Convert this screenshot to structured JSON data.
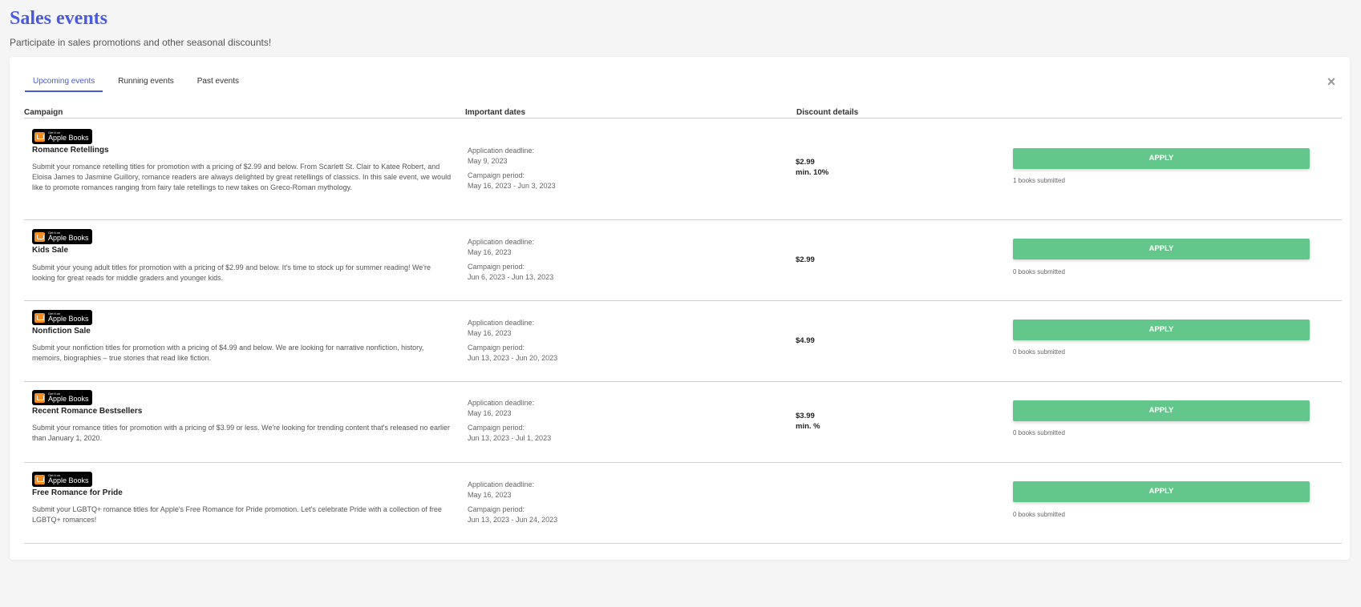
{
  "header": {
    "title": "Sales events",
    "subtitle": "Participate in sales promotions and other seasonal discounts!"
  },
  "tabs": [
    {
      "label": "Upcoming events",
      "active": true
    },
    {
      "label": "Running events",
      "active": false
    },
    {
      "label": "Past events",
      "active": false
    }
  ],
  "close_icon": "×",
  "table": {
    "headers": [
      "Campaign",
      "Important dates",
      "Discount details"
    ],
    "logo": {
      "small": "Get it on",
      "big": "Apple Books"
    },
    "labels": {
      "deadline": "Application deadline:",
      "period": "Campaign period:",
      "apply": "APPLY"
    },
    "rows": [
      {
        "name": "Romance Retellings",
        "description": "Submit your romance retelling titles for promotion with a pricing of $2.99 and below. From Scarlett St. Clair to Katee Robert, and Eloisa James to Jasmine Guillory, romance readers are always delighted by great retellings of classics. In this sale event, we would like to promote romances ranging from fairy tale retellings to new takes on Greco-Roman mythology.",
        "deadline": "May 9, 2023",
        "period": "May 16, 2023 - Jun 3, 2023",
        "price": "$2.99",
        "min": "min. 10%",
        "submitted": "1 books submitted"
      },
      {
        "name": "Kids Sale",
        "description": "Submit your young adult titles for promotion with a pricing of $2.99 and below. It's time to stock up for summer reading! We're looking for great reads for middle graders and younger kids.",
        "deadline": "May 16, 2023",
        "period": "Jun 6, 2023 - Jun 13, 2023",
        "price": "$2.99",
        "min": "",
        "submitted": "0 books submitted"
      },
      {
        "name": "Nonfiction Sale",
        "description": "Submit your nonfiction titles for promotion with a pricing of $4.99 and below. We are looking for narrative nonfiction, history, memoirs, biographies – true stories that read like fiction.",
        "deadline": "May 16, 2023",
        "period": "Jun 13, 2023 - Jun 20, 2023",
        "price": "$4.99",
        "min": "",
        "submitted": "0 books submitted"
      },
      {
        "name": "Recent Romance Bestsellers",
        "description": "Submit your romance titles for promotion with a pricing of $3.99 or less. We're looking for trending content that's released no earlier than January 1, 2020.",
        "deadline": "May 16, 2023",
        "period": "Jun 13, 2023 - Jul 1, 2023",
        "price": "$3.99",
        "min": "min. %",
        "submitted": "0 books submitted"
      },
      {
        "name": "Free Romance for Pride",
        "description": "Submit your LGBTQ+ romance titles for Apple's Free Romance for Pride promotion. Let's celebrate Pride with a collection of free LGBTQ+ romances!",
        "deadline": "May 16, 2023",
        "period": "Jun 13, 2023 - Jun 24, 2023",
        "price": "",
        "min": "",
        "submitted": "0 books submitted"
      }
    ]
  }
}
